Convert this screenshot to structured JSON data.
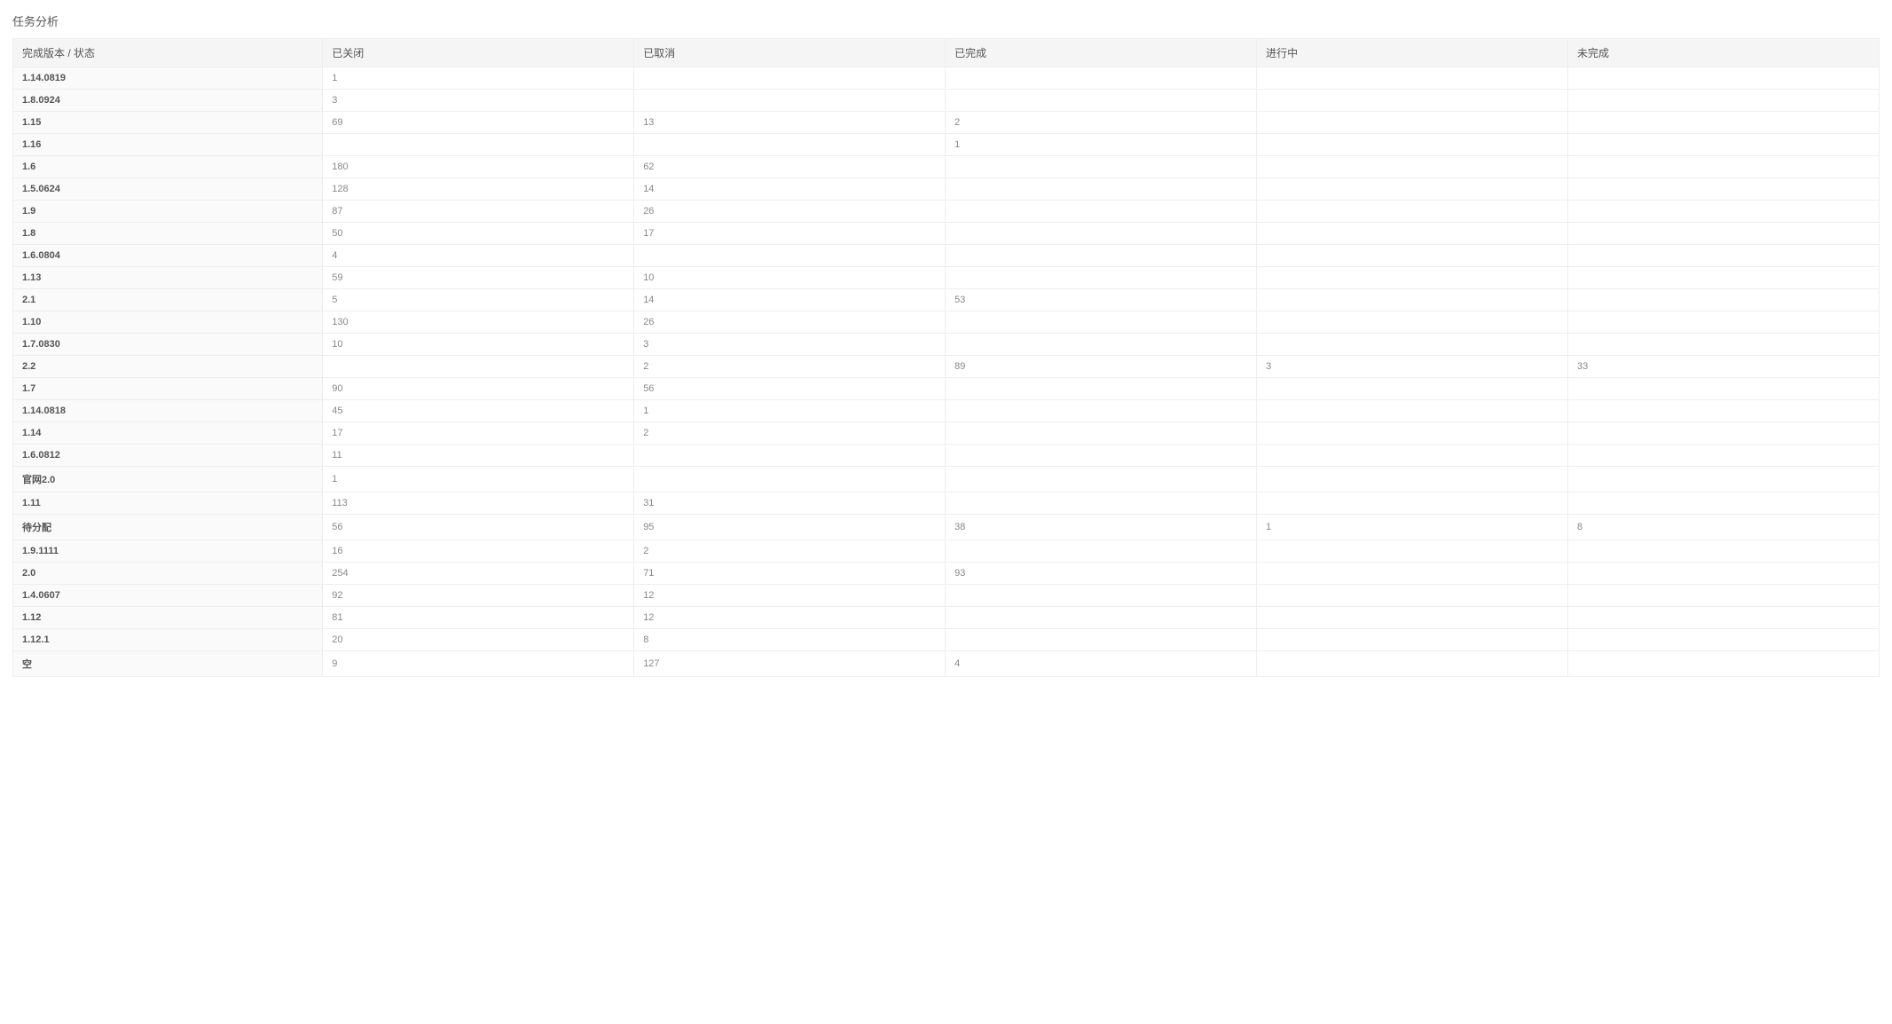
{
  "title": "任务分析",
  "table": {
    "corner_label": "完成版本 / 状态",
    "columns": [
      "已关闭",
      "已取消",
      "已完成",
      "进行中",
      "未完成"
    ],
    "rows": [
      {
        "label": "1.14.0819",
        "values": [
          "1",
          "",
          "",
          "",
          ""
        ]
      },
      {
        "label": "1.8.0924",
        "values": [
          "3",
          "",
          "",
          "",
          ""
        ]
      },
      {
        "label": "1.15",
        "values": [
          "69",
          "13",
          "2",
          "",
          ""
        ]
      },
      {
        "label": "1.16",
        "values": [
          "",
          "",
          "1",
          "",
          ""
        ]
      },
      {
        "label": "1.6",
        "values": [
          "180",
          "62",
          "",
          "",
          ""
        ]
      },
      {
        "label": "1.5.0624",
        "values": [
          "128",
          "14",
          "",
          "",
          ""
        ]
      },
      {
        "label": "1.9",
        "values": [
          "87",
          "26",
          "",
          "",
          ""
        ]
      },
      {
        "label": "1.8",
        "values": [
          "50",
          "17",
          "",
          "",
          ""
        ]
      },
      {
        "label": "1.6.0804",
        "values": [
          "4",
          "",
          "",
          "",
          ""
        ]
      },
      {
        "label": "1.13",
        "values": [
          "59",
          "10",
          "",
          "",
          ""
        ]
      },
      {
        "label": "2.1",
        "values": [
          "5",
          "14",
          "53",
          "",
          ""
        ]
      },
      {
        "label": "1.10",
        "values": [
          "130",
          "26",
          "",
          "",
          ""
        ]
      },
      {
        "label": "1.7.0830",
        "values": [
          "10",
          "3",
          "",
          "",
          ""
        ]
      },
      {
        "label": "2.2",
        "values": [
          "",
          "2",
          "89",
          "3",
          "33"
        ]
      },
      {
        "label": "1.7",
        "values": [
          "90",
          "56",
          "",
          "",
          ""
        ]
      },
      {
        "label": "1.14.0818",
        "values": [
          "45",
          "1",
          "",
          "",
          ""
        ]
      },
      {
        "label": "1.14",
        "values": [
          "17",
          "2",
          "",
          "",
          ""
        ]
      },
      {
        "label": "1.6.0812",
        "values": [
          "11",
          "",
          "",
          "",
          ""
        ]
      },
      {
        "label": "官网2.0",
        "values": [
          "1",
          "",
          "",
          "",
          ""
        ]
      },
      {
        "label": "1.11",
        "values": [
          "113",
          "31",
          "",
          "",
          ""
        ]
      },
      {
        "label": "待分配",
        "values": [
          "56",
          "95",
          "38",
          "1",
          "8"
        ]
      },
      {
        "label": "1.9.1111",
        "values": [
          "16",
          "2",
          "",
          "",
          ""
        ]
      },
      {
        "label": "2.0",
        "values": [
          "254",
          "71",
          "93",
          "",
          ""
        ]
      },
      {
        "label": "1.4.0607",
        "values": [
          "92",
          "12",
          "",
          "",
          ""
        ]
      },
      {
        "label": "1.12",
        "values": [
          "81",
          "12",
          "",
          "",
          ""
        ]
      },
      {
        "label": "1.12.1",
        "values": [
          "20",
          "8",
          "",
          "",
          ""
        ]
      },
      {
        "label": "空",
        "values": [
          "9",
          "127",
          "4",
          "",
          ""
        ]
      }
    ]
  }
}
